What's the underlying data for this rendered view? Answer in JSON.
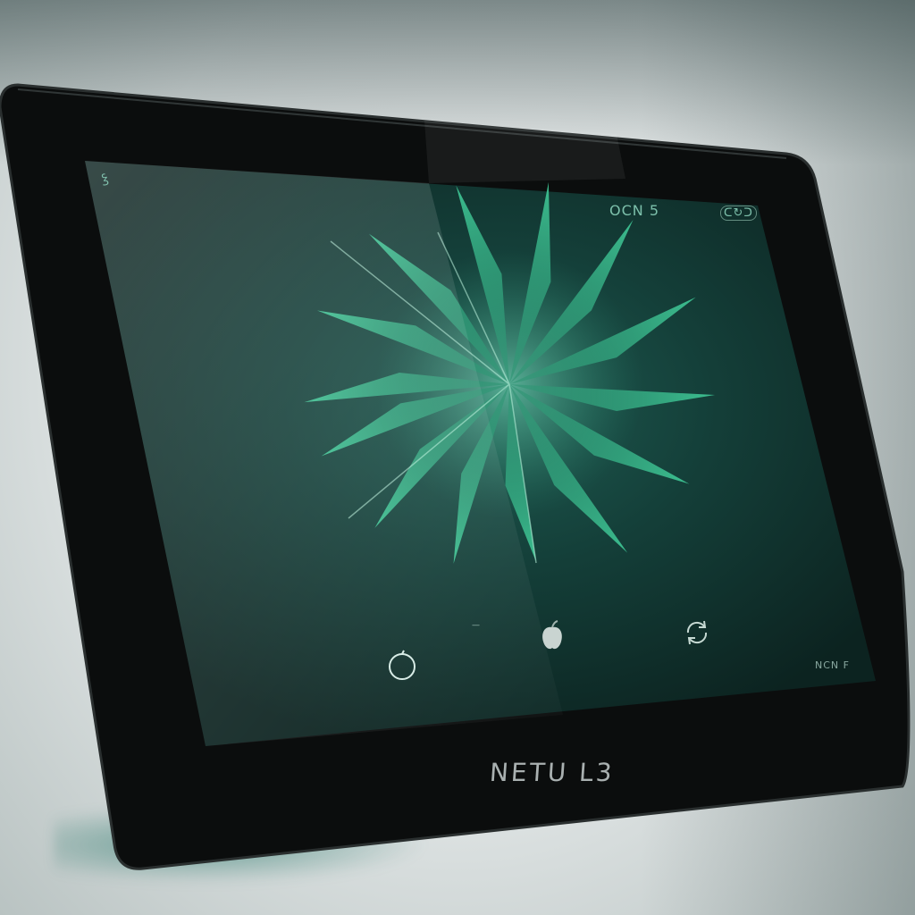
{
  "device": {
    "brand_label": "NETU L3",
    "bezel_color": "#0b0d0d",
    "screen_tint": "#103a35",
    "accent_color": "#3fbf8f"
  },
  "screen": {
    "status_left": "ꝣ",
    "status_center": "OCN 5",
    "status_right": "ᑕ↻ᑐ",
    "footer_text": "NCN F",
    "dock_separator": "—",
    "wallpaper": "green-starburst"
  },
  "dock": {
    "items": [
      {
        "icon": "circle-icon"
      },
      {
        "icon": "apple-icon"
      },
      {
        "icon": "sync-icon"
      }
    ]
  }
}
